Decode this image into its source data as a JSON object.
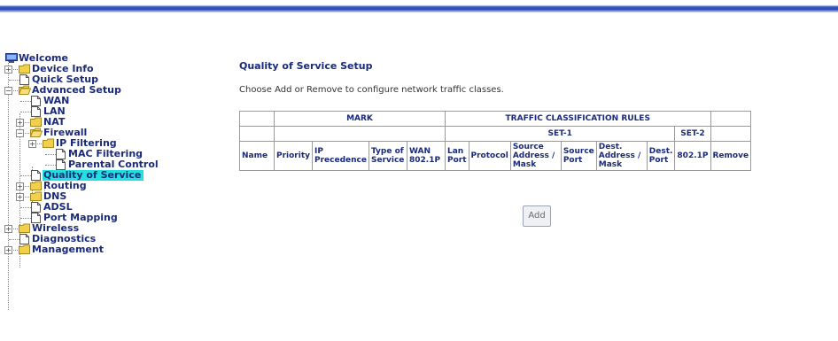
{
  "tree": {
    "welcome": "Welcome",
    "device_info": "Device Info",
    "quick_setup": "Quick Setup",
    "advanced_setup": "Advanced Setup",
    "wan": "WAN",
    "lan": "LAN",
    "nat": "NAT",
    "firewall": "Firewall",
    "ip_filtering": "IP Filtering",
    "mac_filtering": "MAC Filtering",
    "parental_control": "Parental Control",
    "qos": "Quality of Service",
    "routing": "Routing",
    "dns": "DNS",
    "adsl": "ADSL",
    "port_mapping": "Port Mapping",
    "wireless": "Wireless",
    "diagnostics": "Diagnostics",
    "management": "Management",
    "expand_glyph": "+",
    "collapse_glyph": "−"
  },
  "main": {
    "title": "Quality of Service Setup",
    "description": "Choose Add or Remove to configure network traffic classes.",
    "mark_header": "MARK",
    "traffic_header": "TRAFFIC CLASSIFICATION RULES",
    "set1_header": "SET-1",
    "set2_header": "SET-2",
    "columns": {
      "name": "Name",
      "priority": "Priority",
      "ip_precedence": "IP Precedence",
      "type_of_service": "Type of Service",
      "wan_8021p": "WAN 802.1P",
      "lan_port": "Lan Port",
      "protocol": "Protocol",
      "source_addr": "Source Address / Mask",
      "source_port": "Source Port",
      "dest_addr": "Dest. Address / Mask",
      "dest_port": "Dest. Port",
      "set2_8021p": "802.1P",
      "remove": "Remove"
    },
    "add_button": "Add"
  },
  "colors": {
    "link_text": "#1a2a7a",
    "selected_highlight": "#22e0e0",
    "folder": "#f2d04a"
  }
}
